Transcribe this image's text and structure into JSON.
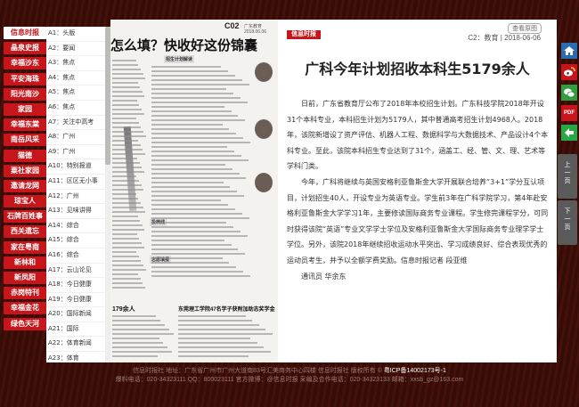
{
  "left_tabs": [
    "信息时报",
    "晶泉史报",
    "幸福沙东",
    "平安海珠",
    "阳光南沙",
    "家园",
    "幸福东棠",
    "南岳风采",
    "猫德",
    "粟社家园",
    "邀请龙网",
    "琼宝人",
    "石牌百姓事",
    "西关遗忘",
    "家在粤南",
    "新林和",
    "新凤阳",
    "赤岗特刊",
    "幸福金花",
    "绿色天河"
  ],
  "sections": [
    "A1：头版",
    "A2：要闻",
    "A3：焦点",
    "A4：焦点",
    "A5：焦点",
    "A6：焦点",
    "A7：关注中高考",
    "A8：广州",
    "A9：广州",
    "A10：特别报道",
    "A11：区区无小事",
    "A12：广州",
    "A13：见味讲得",
    "A14：综合",
    "A15：综合",
    "A16：综合",
    "A17：云山论见",
    "A18：今日健康",
    "A19：今日健康",
    "A20：国际新闻",
    "A21：国际",
    "A22：体育新闻",
    "A23：体育"
  ],
  "newspaper": {
    "page_id": "C02",
    "page_info": "广东教育 2018.06.06",
    "headline": "怎么填？快收好这份锦囊",
    "headline2": "179余人",
    "headline3": "东莞理工学院47名学子获附加助志奖学金",
    "subheads": [
      "招生计划解读",
      "投档线",
      "志愿填报"
    ]
  },
  "article": {
    "logo": "信息时报",
    "source_link": "查看原图",
    "page_meta": "C2：教育 | 2018-06-06",
    "title": "广科今年计划招收本科生5179余人",
    "paragraphs": [
      "日前，广东省教育厅公布了2018年本校招生计划。广东科技学院2018年开设31个本科专业，本科招生计划为5179人，其中普通高考招生计划4968人。2018年，该院新增设了资产评估、机器人工程、数据科学与大数据技术、产品设计4个本科专业。至此，该院本科招生专业达到了31个，涵盖工、经、管、文、理、艺术等学科门类。",
      "今年，广科将继续与英国安格利亚鲁斯金大学开展联合培养“3+1”学分互认项目，计划招生40人，开设专业为英语专业。学生前3年在广科学院学习，第4年赴安格利亚鲁斯金大学学习1年，主要修读国际商务专业课程。学生修完课程学分，可同时获得该院“英语”专业文学学士学位及安格利亚鲁斯金大学国际商务专业理学学士学位。另外，该院2018年继续招收运动水平突出、学习成绩良好、综合表现优秀的运动员考生，并予以全额学费奖励。信息时报记者 段亚维",
      "通讯员 华余东"
    ]
  },
  "right_buttons": {
    "pdf": "PDF",
    "prev": "上一页",
    "next": "下一页"
  },
  "footer": {
    "line1": "信息时报社 地址：广东省广州市广州大道南83号汇美商务中心四楼 信息时报社 版权所有 ©",
    "icp": "粤ICP备14002173号-1",
    "line2": "爆料电话：020-34323111 QQ：800023111 官方微博：@信息时报 采编及合作电话：020-34323133 邮箱：xxsb_gz@163.com"
  }
}
